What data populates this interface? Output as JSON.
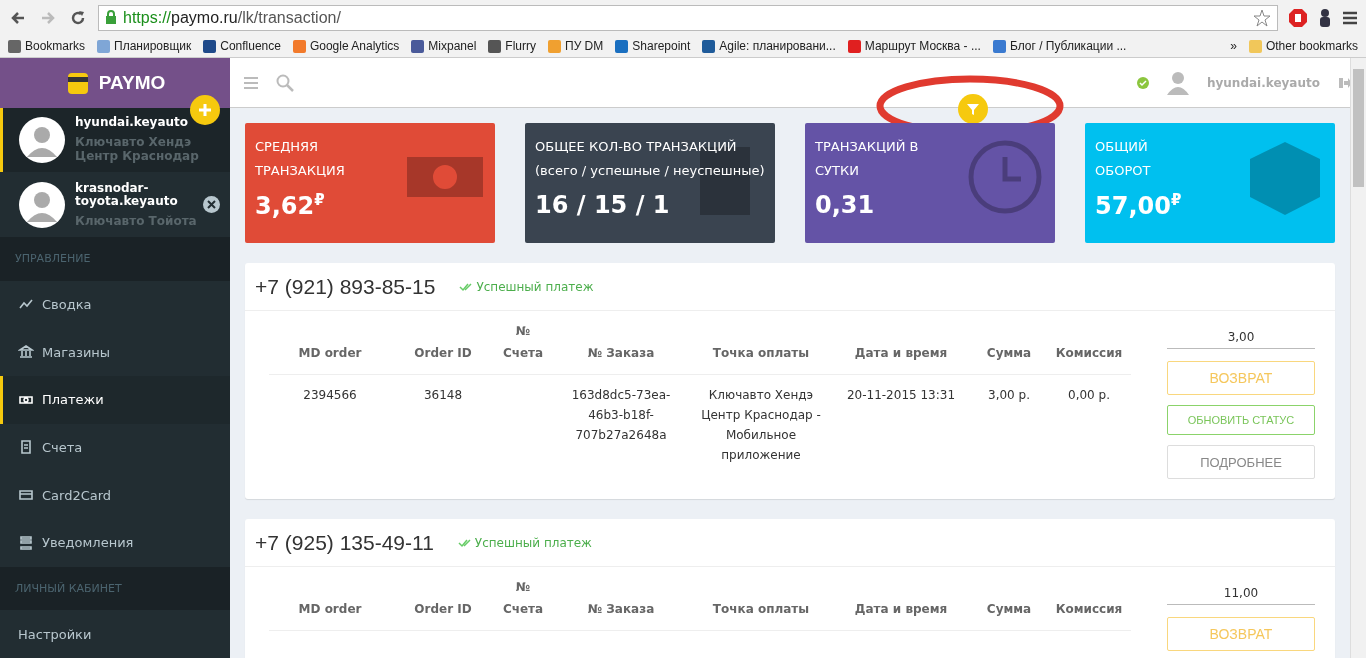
{
  "browser": {
    "url_scheme": "https://",
    "url_host": "paymo.ru",
    "url_path": "/lk/transaction/",
    "bookmarks": [
      "Bookmarks",
      "Планировщик",
      "Confluence",
      "Google Analytics",
      "Mixpanel",
      "Flurry",
      "ПУ DM",
      "Sharepoint",
      "Agile: планировани...",
      "Маршрут Москва - ...",
      "Блог / Публикации ..."
    ],
    "overflow": "»",
    "other_bookmarks": "Other bookmarks"
  },
  "sidebar": {
    "logo": "PAYMO",
    "accounts": [
      {
        "login": "hyundai.keyauto",
        "name": "Ключавто Хендэ Центр Краснодар",
        "selected": true
      },
      {
        "login": "krasnodar-toyota.keyauto",
        "name": "Ключавто Тойота",
        "selected": false
      }
    ],
    "sections": [
      {
        "title": "УПРАВЛЕНИЕ",
        "items": [
          {
            "label": "Сводка",
            "selected": false
          },
          {
            "label": "Магазины",
            "selected": false
          },
          {
            "label": "Платежи",
            "selected": true
          },
          {
            "label": "Счета",
            "selected": false
          },
          {
            "label": "Card2Card",
            "selected": false
          },
          {
            "label": "Уведомления",
            "selected": false
          }
        ]
      },
      {
        "title": "ЛИЧНЫЙ КАБИНЕТ",
        "items": [
          {
            "label": "Настройки",
            "selected": false
          }
        ]
      }
    ]
  },
  "topbar": {
    "user": "hyundai.keyauto"
  },
  "stats": [
    {
      "title_lines": [
        "СРЕДНЯЯ",
        "ТРАНЗАКЦИЯ"
      ],
      "value": "3,62$^{₽}$",
      "color": "#e04b37"
    },
    {
      "title_lines": [
        "ОБЩЕЕ КОЛ-ВО ТРАНЗАКЦИЙ",
        "(всего / успешные / неуспешные)"
      ],
      "value": "16 / 15 / 1",
      "color": "#3a4450"
    },
    {
      "title_lines": [
        "ТРАНЗАКЦИЙ В",
        "СУТКИ"
      ],
      "value": "0,31",
      "color": "#6453a6"
    },
    {
      "title_lines": [
        "ОБЩИЙ",
        "ОБОРОТ"
      ],
      "value": "57,00$^{₽}$",
      "color": "#00c0ef"
    }
  ],
  "transactions": [
    {
      "phone": "+7 (921) 893-85-15",
      "status": "Успешный платеж",
      "columns": [
        "MD order",
        "Order ID",
        "№ Счета",
        "№ Заказа",
        "Точка оплаты",
        "Дата и время",
        "Сумма",
        "Комиссия"
      ],
      "rows": [
        [
          "2394566",
          "36148",
          "",
          "163d8dc5-73ea-46b3-b18f-707b27a2648a",
          "Ключавто Хендэ Центр Краснодар - Мобильное приложение",
          "20-11-2015 13:31",
          "3,00 р.",
          "0,00 р."
        ]
      ],
      "amount": "3,00",
      "buttons": [
        {
          "label": "ВОЗВРАТ",
          "kind": "refund"
        },
        {
          "label": "ОБНОВИТЬ СТАТУС",
          "kind": "update"
        },
        {
          "label": "ПОДРОБНЕЕ",
          "kind": "details"
        }
      ]
    },
    {
      "phone": "+7 (925) 135-49-11",
      "status": "Успешный платеж",
      "columns": [
        "MD order",
        "Order ID",
        "№ Счета",
        "№ Заказа",
        "Точка оплаты",
        "Дата и время",
        "Сумма",
        "Комиссия"
      ],
      "amount": "11,00",
      "buttons": [
        {
          "label": "ВОЗВРАТ",
          "kind": "refund"
        }
      ]
    }
  ]
}
